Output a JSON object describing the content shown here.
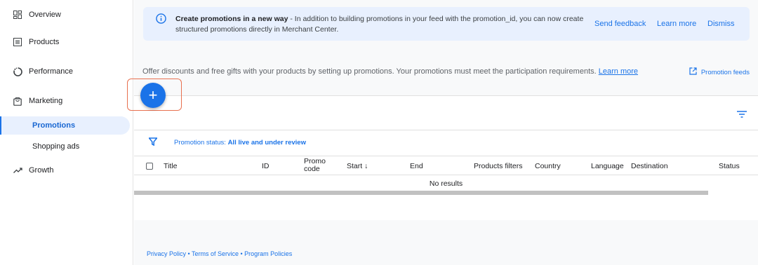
{
  "sidebar": {
    "items": [
      {
        "label": "Overview",
        "icon": "dashboard-icon"
      },
      {
        "label": "Products",
        "icon": "list-icon"
      },
      {
        "label": "Performance",
        "icon": "circle-progress-icon"
      },
      {
        "label": "Marketing",
        "icon": "shopping-bag-icon"
      },
      {
        "label": "Promotions",
        "active": true
      },
      {
        "label": "Shopping ads"
      },
      {
        "label": "Growth",
        "icon": "trending-up-icon"
      }
    ]
  },
  "banner": {
    "title": "Create promotions in a new way",
    "message": " - In addition to building promotions in your feed with the promotion_id, you can now create structured promotions directly in Merchant Center.",
    "send_feedback": "Send feedback",
    "learn_more": "Learn more",
    "dismiss": "Dismiss"
  },
  "intro": {
    "text": "Offer discounts and free gifts with your products by setting up promotions. Your promotions must meet the participation requirements. ",
    "link": "Learn more",
    "feeds": "Promotion feeds"
  },
  "fab": {
    "label": "+"
  },
  "filter": {
    "label": "Promotion status: ",
    "value": "All live and under review"
  },
  "table": {
    "columns": {
      "title": "Title",
      "id": "ID",
      "promo_line1": "Promo",
      "promo_line2": "code",
      "start": "Start ↓",
      "end": "End",
      "products_filters": "Products filters",
      "country": "Country",
      "language": "Language",
      "destination": "Destination",
      "status": "Status"
    },
    "empty": "No results"
  },
  "footer": {
    "text": "Privacy Policy • Terms of Service • Program Policies"
  },
  "colors": {
    "accent": "#1a73e8",
    "banner_bg": "#e8f0fe",
    "highlight": "#e8704f"
  }
}
